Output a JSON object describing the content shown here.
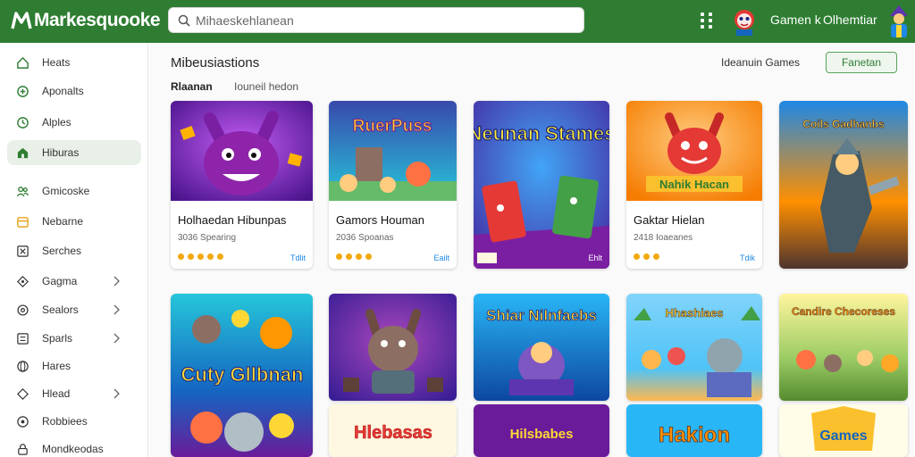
{
  "topbar": {
    "brand": "Markesquooke",
    "search_placeholder": "Mihaeskehlanean",
    "profile_name": "Gamen k",
    "profile_menu": "Olhemtiar"
  },
  "sidebar": {
    "items": [
      {
        "label": "Heats",
        "icon": "home-icon"
      },
      {
        "label": "Aponalts",
        "icon": "plus-circle-icon"
      },
      {
        "label": "Alples",
        "icon": "clock-icon"
      },
      {
        "label": "Hiburas",
        "icon": "home-filled-icon"
      },
      {
        "label": "Gmicoske",
        "icon": "users-icon"
      },
      {
        "label": "Nebarne",
        "icon": "calendar-icon"
      },
      {
        "label": "Serches",
        "icon": "tag-icon"
      },
      {
        "label": "Gagma",
        "icon": "diamond-icon"
      },
      {
        "label": "Sealors",
        "icon": "gear-icon"
      },
      {
        "label": "Sparls",
        "icon": "list-icon"
      },
      {
        "label": "Hares",
        "icon": "globe-icon"
      },
      {
        "label": "Hlead",
        "icon": "shield-icon"
      },
      {
        "label": "Robbiees",
        "icon": "info-icon"
      },
      {
        "label": "Mondkeodas",
        "icon": "lock-icon"
      }
    ]
  },
  "main": {
    "title": "Mibeusiastions",
    "subtitle_bold": "Rlaanan",
    "subtitle_light": "Iouneil hedon",
    "filter_label": "Ideanuin Games",
    "filter_button": "Fanetan",
    "cards_row1": [
      {
        "art_text": "",
        "title": "Holhaedan Hibunpas",
        "meta": "3036 Spearing",
        "badge": "Tdlit"
      },
      {
        "art_text": "RuerPuss",
        "title": "Gamors Houman",
        "meta": "2036 Spoanas",
        "badge": "Eailt"
      },
      {
        "art_text": "Neunan Stames",
        "title": "",
        "meta": "",
        "badge": "Ehlt"
      },
      {
        "art_text": "Nahik Hacan",
        "title": "Gaktar Hielan",
        "meta": "2418 Ioaeanes",
        "badge": "Tdik"
      },
      {
        "art_text": "Coils Gadhanbs",
        "title": "",
        "meta": "",
        "badge": ""
      }
    ],
    "cards_row2": [
      {
        "art_text": "Cuty Gllbnan"
      },
      {
        "art_text": ""
      },
      {
        "art_text": "Shiar Nilnfaebs"
      },
      {
        "art_text": "Hhashiaes"
      },
      {
        "art_text": "Candire Checoreses"
      }
    ],
    "cards_row3": [
      {
        "art_text": ""
      },
      {
        "art_text": "Hlebasas"
      },
      {
        "art_text": "Hilsbabes"
      },
      {
        "art_text": "Hakion"
      },
      {
        "art_text": "Games"
      }
    ]
  },
  "colors": {
    "brand_green": "#2e7d32",
    "accent_orange": "#f2a90d",
    "badge_blue": "#1e88e5"
  }
}
